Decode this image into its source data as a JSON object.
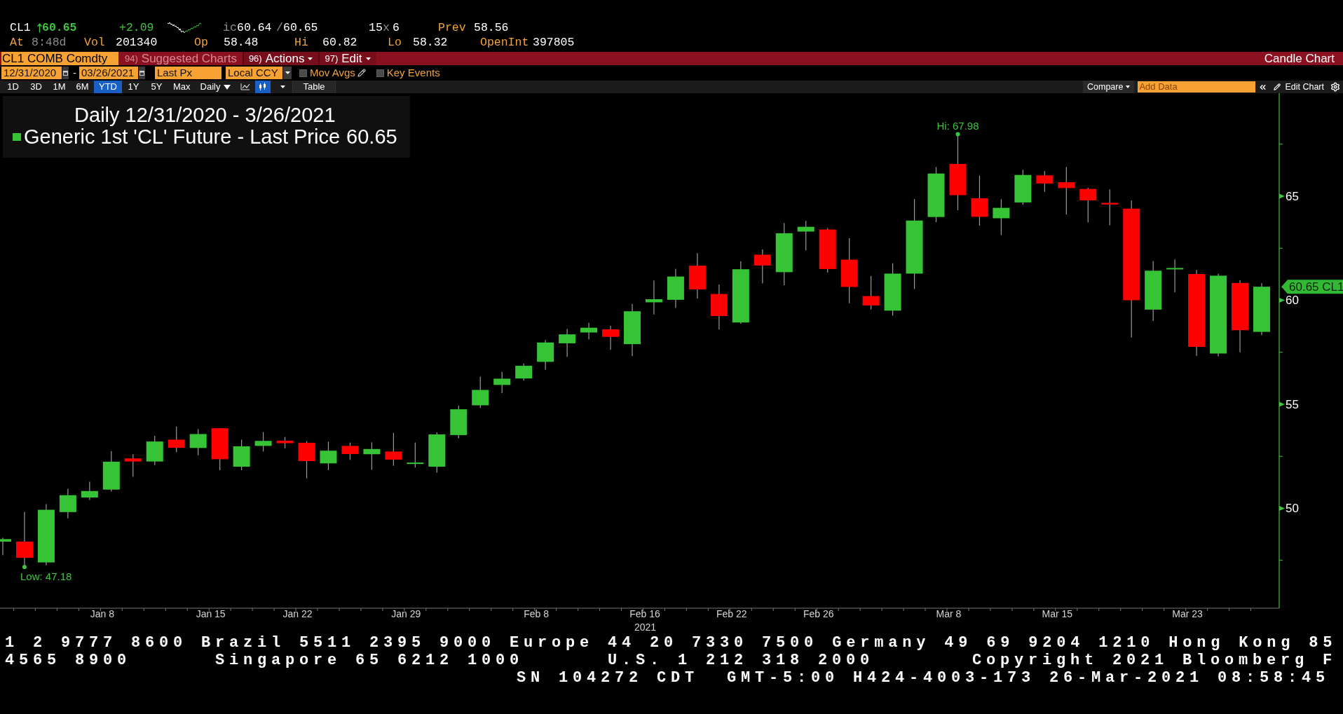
{
  "quote": {
    "ticker": "CL1",
    "rising": true,
    "last": "60.65",
    "change": "+2.09",
    "condition_code": "ic",
    "bid": "60.64",
    "separator": "/",
    "ask": "60.65",
    "bid_size": "15",
    "size_separator": "x",
    "ask_size": "6",
    "prev_label": "Prev",
    "prev": "58.56"
  },
  "stats": [
    {
      "label": "At",
      "value": "8:48d",
      "muted": true
    },
    {
      "label": "Vol",
      "value": "201340",
      "muted": false
    },
    {
      "label": "Op",
      "value": "58.48",
      "muted": false
    },
    {
      "label": "Hi",
      "value": "60.82",
      "muted": false
    },
    {
      "label": "Lo",
      "value": "58.32",
      "muted": false
    },
    {
      "label": "OpenInt",
      "value": "397805",
      "muted": false
    }
  ],
  "menu_bar": {
    "security": "CL1 COMB Comdty",
    "items": [
      {
        "number": "94)",
        "label": "Suggested Charts",
        "disabled": true,
        "has_menu": false
      },
      {
        "number": "96)",
        "label": "Actions",
        "disabled": false,
        "has_menu": true
      },
      {
        "number": "97)",
        "label": "Edit",
        "disabled": false,
        "has_menu": true
      }
    ],
    "title": "Candle Chart"
  },
  "settings_bar": {
    "start_date": "12/31/2020",
    "date_separator": "-",
    "end_date": "03/26/2021",
    "price_field": "Last Px",
    "currency": "Local CCY",
    "toggles": [
      {
        "label": "Mov Avgs",
        "checked": false,
        "editable": true
      },
      {
        "label": "Key Events",
        "checked": false,
        "editable": false
      }
    ]
  },
  "toolbar": {
    "ranges": [
      {
        "label": "1D",
        "selected": false
      },
      {
        "label": "3D",
        "selected": false
      },
      {
        "label": "1M",
        "selected": false
      },
      {
        "label": "6M",
        "selected": false
      },
      {
        "label": "YTD",
        "selected": true
      },
      {
        "label": "1Y",
        "selected": false
      },
      {
        "label": "5Y",
        "selected": false
      },
      {
        "label": "Max",
        "selected": false
      }
    ],
    "frequency": "Daily",
    "chart_types": [
      {
        "kind": "line",
        "selected": false
      },
      {
        "kind": "candle",
        "selected": true
      }
    ],
    "table_button": "Table",
    "compare_button": "Compare",
    "add_data": {
      "placeholder": "Add Data"
    },
    "edit_chart_button": "Edit Chart"
  },
  "legend": {
    "title": "Daily 12/31/2020 - 3/26/2021",
    "series": [
      {
        "name": "Generic 1st 'CL' Future - Last Price",
        "value": "60.65",
        "color": "#36c436"
      }
    ]
  },
  "chart": {
    "y_axis_labels": [
      "65",
      "60",
      "55",
      "50"
    ],
    "x_axis_labels": [
      "Jan 8",
      "Jan 15",
      "Jan 22",
      "Jan 29",
      "Feb 8",
      "Feb 16",
      "Feb 22",
      "Feb 26",
      "Mar 8",
      "Mar 15",
      "Mar 23"
    ],
    "year_label": "2021",
    "high_label": "Hi: 67.98",
    "low_label": "Low: 47.18",
    "price_tag": "60.65 CL1"
  },
  "ticker": [
    {
      "kind": "left",
      "items": [
        "1 2 9777 8600 Brazil 5511 2395 9000 Europe 44 20 7330 7500 Germany 49 69 9204 1210 Hong Kong 85"
      ]
    },
    {
      "kind": "columns",
      "items": [
        "4565 8900",
        "Singapore 65 6212 1000",
        "U.S. 1 212 318 2000",
        "Copyright 2021 Bloomberg F"
      ]
    },
    {
      "kind": "offset",
      "items": [
        "SN 104272 CDT  GMT-5:00 H424-4003-173 26-Mar-2021 08:58:45"
      ]
    }
  ]
}
